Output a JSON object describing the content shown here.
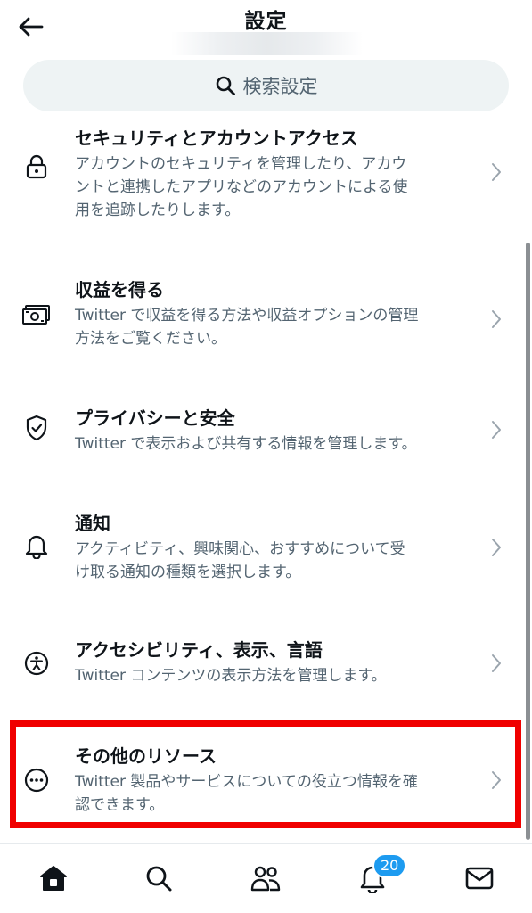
{
  "header": {
    "title": "設定",
    "back_icon": "arrow-left-icon"
  },
  "search": {
    "label": "検索設定",
    "icon": "search-icon"
  },
  "items": [
    {
      "title": "セキュリティとアカウントアクセス",
      "desc_lines": [
        "アカウントのセキュリティを管理したり、アカウ",
        "ントと連携したアプリなどのアカウントによる使",
        "用を追跡したりします。"
      ],
      "icon": "lock-icon"
    },
    {
      "title": "収益を得る",
      "desc_lines": [
        "Twitter で収益を得る方法や収益オプションの管理",
        "方法をご覧ください。"
      ],
      "icon": "money-icon"
    },
    {
      "title": "プライバシーと安全",
      "desc_lines": [
        "Twitter で表示および共有する情報を管理します。"
      ],
      "icon": "shield-check-icon"
    },
    {
      "title": "通知",
      "desc_lines": [
        "アクティビティ、興味関心、おすすめについて受",
        "け取る通知の種類を選択します。"
      ],
      "icon": "bell-icon"
    },
    {
      "title": "アクセシビリティ、表示、言語",
      "desc_lines": [
        "Twitter コンテンツの表示方法を管理します。"
      ],
      "icon": "accessibility-icon"
    },
    {
      "title": "その他のリソース",
      "desc_lines": [
        "Twitter 製品やサービスについての役立つ情報を確",
        "認できます。"
      ],
      "icon": "more-circle-icon"
    }
  ],
  "tabbar": {
    "tabs": [
      "home-icon",
      "search-icon",
      "communities-icon",
      "notifications-icon",
      "messages-icon"
    ],
    "notification_badge": "20"
  },
  "colors": {
    "text_primary": "#0f1419",
    "text_secondary": "#536471",
    "search_bg": "#eef3f4",
    "badge": "#1d9bf0",
    "highlight": "#f00000"
  }
}
